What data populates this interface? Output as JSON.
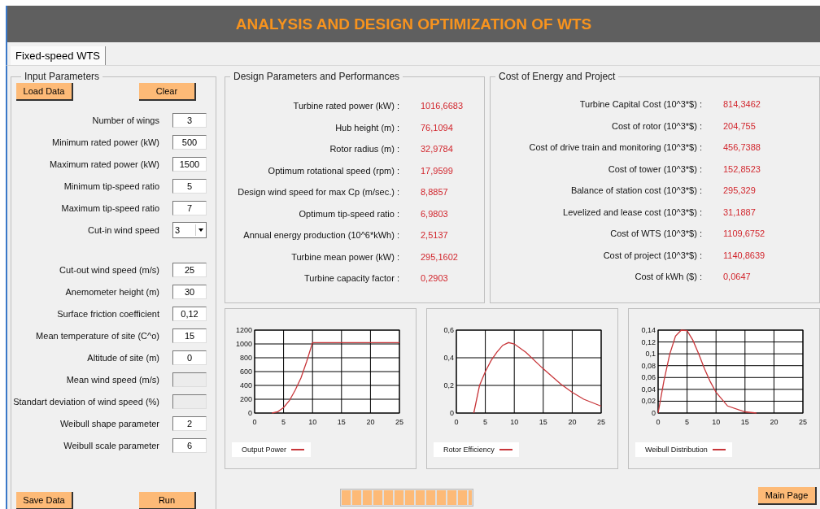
{
  "title": "ANALYSIS AND DESIGN OPTIMIZATION OF WTS",
  "tabs": [
    {
      "label": "Fixed-speed WTS",
      "selected": true
    }
  ],
  "input_parameters": {
    "title": "Input Parameters",
    "top_buttons": [
      "Load Data",
      "Clear"
    ],
    "fields": [
      {
        "label": "Number of wings",
        "kind": "field",
        "value": "3",
        "disabled": false
      },
      {
        "label": "Minimum rated power  (kW)",
        "kind": "field",
        "value": "500",
        "disabled": false
      },
      {
        "label": "Maximum rated power  (kW)",
        "kind": "field",
        "value": "1500",
        "disabled": false
      },
      {
        "label": "Minimum tip-speed ratio",
        "kind": "field",
        "value": "5",
        "disabled": false
      },
      {
        "label": "Maximum tip-speed ratio",
        "kind": "field",
        "value": "7",
        "disabled": false
      },
      {
        "label": "Cut-in wind speed",
        "kind": "dropdown",
        "value": "3"
      },
      {
        "label": "Cut-out wind speed  (m/s)",
        "kind": "field",
        "value": "25",
        "disabled": false
      },
      {
        "label": "Anemometer height  (m)",
        "kind": "field",
        "value": "30",
        "disabled": false
      },
      {
        "label": "Surface friction coefficient",
        "kind": "field",
        "value": "0,12",
        "disabled": false
      },
      {
        "label": "Mean temperature of site  (C^o)",
        "kind": "field",
        "value": "15",
        "disabled": false
      },
      {
        "label": "Altitude of site  (m)",
        "kind": "field",
        "value": "0",
        "disabled": false
      },
      {
        "label": "Mean wind speed  (m/s)",
        "kind": "field",
        "disabled": true
      },
      {
        "label": "Standart deviation of wind speed  (%)",
        "kind": "field",
        "disabled": true
      },
      {
        "label": "Weibull shape parameter",
        "kind": "field",
        "value": "2",
        "disabled": false
      },
      {
        "label": "Weibull scale parameter",
        "kind": "field",
        "value": "6",
        "disabled": false
      }
    ],
    "bottom_buttons": [
      "Save Data",
      "Run"
    ]
  },
  "design": {
    "title": "Design Parameters  and Performances",
    "rows": [
      {
        "label": "Turbine rated power  (kW) :",
        "value": "1016,6683"
      },
      {
        "label": "Hub height  (m) :",
        "value": "76,1094"
      },
      {
        "label": "Rotor radius  (m) :",
        "value": "32,9784"
      },
      {
        "label": "Optimum rotational speed  (rpm) :",
        "value": "17,9599"
      },
      {
        "label": "Design wind speed for max Cp  (m/sec.) :",
        "value": "8,8857"
      },
      {
        "label": "Optimum tip-speed ratio :",
        "value": "6,9803"
      },
      {
        "label": "Annual energy production  (10^6*kWh) :",
        "value": "2,5137"
      },
      {
        "label": "Turbine mean power  (kW) :",
        "value": "295,1602"
      },
      {
        "label": "Turbine capacity factor :",
        "value": "0,2903"
      }
    ]
  },
  "cost": {
    "title": "Cost of Energy and Project",
    "rows": [
      {
        "label": "Turbine Capital Cost  (10^3*$) :",
        "value": "814,3462"
      },
      {
        "label": "Cost of rotor  (10^3*$) :",
        "value": "204,755"
      },
      {
        "label": "Cost of drive train and monitoring  (10^3*$) :",
        "value": "456,7388"
      },
      {
        "label": "Cost of tower  (10^3*$) :",
        "value": "152,8523"
      },
      {
        "label": "Balance of station cost  (10^3*$) :",
        "value": "295,329"
      },
      {
        "label": "Levelized and lease cost  (10^3*$) :",
        "value": "31,1887"
      },
      {
        "label": "Cost of WTS  (10^3*$) :",
        "value": "1109,6752"
      },
      {
        "label": "Cost of project  (10^3*$) :",
        "value": "1140,8639"
      },
      {
        "label": "Cost of kWh  ($) :",
        "value": "0,0647"
      }
    ]
  },
  "charts": [
    {
      "chart_data": {
        "type": "line",
        "grid": true,
        "x": [
          3,
          4,
          5,
          6,
          7,
          8,
          9,
          10,
          15,
          20,
          25
        ],
        "series": [
          {
            "name": "Output Power",
            "color": "#c8363a",
            "values": [
              0,
              20,
              80,
              180,
              330,
              510,
              750,
              1020,
              1020,
              1020,
              1020
            ]
          }
        ],
        "xlim": [
          0,
          25
        ],
        "ylim": [
          0,
          1200
        ],
        "xticks": [
          0,
          5,
          10,
          15,
          20,
          25
        ],
        "yticks": [
          0,
          200,
          400,
          600,
          800,
          1000,
          1200
        ]
      }
    },
    {
      "chart_data": {
        "type": "line",
        "grid": true,
        "x": [
          3,
          4,
          5,
          6,
          7,
          8,
          9,
          10,
          12,
          15,
          18,
          20,
          22,
          25
        ],
        "series": [
          {
            "name": "Rotor Efficiency",
            "color": "#c8363a",
            "values": [
              0,
              0.2,
              0.3,
              0.38,
              0.44,
              0.49,
              0.51,
              0.5,
              0.44,
              0.32,
              0.21,
              0.15,
              0.1,
              0.05
            ]
          }
        ],
        "xlim": [
          0,
          25
        ],
        "ylim": [
          0,
          0.6
        ],
        "xticks": [
          0,
          5,
          10,
          15,
          20,
          25
        ],
        "yticks": [
          {
            "value": 0,
            "label": "0"
          },
          {
            "value": 0.2,
            "label": "0,2"
          },
          {
            "value": 0.4,
            "label": "0,4"
          },
          {
            "value": 0.6,
            "label": "0,6"
          }
        ]
      }
    },
    {
      "chart_data": {
        "type": "line",
        "grid": true,
        "x": [
          0,
          1,
          2,
          3,
          4,
          5,
          6,
          7,
          8,
          9,
          10,
          12,
          15,
          17
        ],
        "series": [
          {
            "name": "Weibull Distribution",
            "color": "#c8363a",
            "values": [
              0,
              0.054,
              0.099,
              0.13,
              0.14,
              0.139,
              0.123,
              0.1,
              0.075,
              0.053,
              0.035,
              0.012,
              0.002,
              0
            ]
          }
        ],
        "xlim": [
          0,
          25
        ],
        "ylim": [
          0,
          0.14
        ],
        "xticks": [
          0,
          5,
          10,
          15,
          20,
          25
        ],
        "yticks": [
          {
            "value": 0,
            "label": "0"
          },
          {
            "value": 0.02,
            "label": "0,02"
          },
          {
            "value": 0.04,
            "label": "0,04"
          },
          {
            "value": 0.06,
            "label": "0,06"
          },
          {
            "value": 0.08,
            "label": "0,08"
          },
          {
            "value": 0.1,
            "label": "0,1"
          },
          {
            "value": 0.12,
            "label": "0,12"
          },
          {
            "value": 0.14,
            "label": "0,14"
          }
        ]
      }
    }
  ],
  "progress": {
    "level": 1
  },
  "main_button": "Main Page"
}
